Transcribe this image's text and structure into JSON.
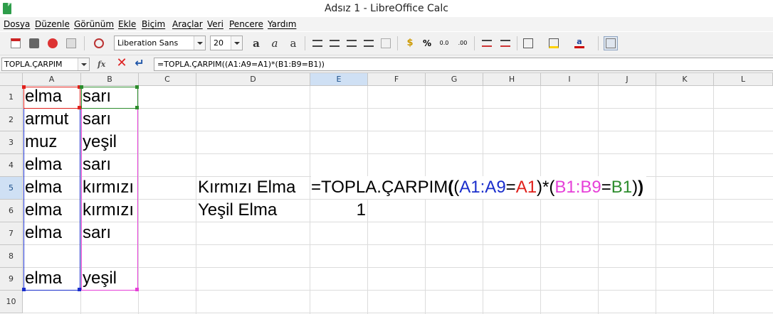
{
  "window": {
    "title": "Adsız 1 - LibreOffice Calc"
  },
  "menu": [
    "Dosya",
    "Düzenle",
    "Görünüm",
    "Ekle",
    "Biçim",
    "Araçlar",
    "Veri",
    "Pencere",
    "Yardım"
  ],
  "toolbar": {
    "font_name": "Liberation Sans",
    "font_size": "20"
  },
  "formula_bar": {
    "name_box": "TOPLA.ÇARPIM",
    "formula": "=TOPLA.ÇARPIM((A1:A9=A1)*(B1:B9=B1))"
  },
  "columns": [
    "A",
    "B",
    "C",
    "D",
    "E",
    "F",
    "G",
    "H",
    "I",
    "J",
    "K",
    "L"
  ],
  "rows": [
    "1",
    "2",
    "3",
    "4",
    "5",
    "6",
    "7",
    "8",
    "9",
    "10"
  ],
  "active_cell": "E5",
  "cells": {
    "A1": "elma",
    "B1": "sarı",
    "A2": "armut",
    "B2": "sarı",
    "A3": "muz",
    "B3": "yeşil",
    "A4": "elma",
    "B4": "sarı",
    "A5": "elma",
    "B5": "kırmızı",
    "D5": "Kırmızı Elma",
    "A6": "elma",
    "B6": "kırmızı",
    "D6": "Yeşil Elma",
    "E6": "1",
    "A7": "elma",
    "B7": "sarı",
    "A9": "elma",
    "B9": "yeşil"
  },
  "edit_formula": {
    "p1": "=TOPLA.ÇARPIM",
    "p2": "(",
    "p3": "(",
    "p4": "A1:A9",
    "p5": "=",
    "p6": "A1",
    "p7": ")*(",
    "p8": "B1:B9",
    "p9": "=",
    "p10": "B1",
    "p11": ")",
    "p12": ")"
  },
  "colors": {
    "ref_red": "#e0201b",
    "ref_blue": "#1a2ecc",
    "ref_magenta": "#e63fd8",
    "ref_green": "#2d8c2d",
    "active_header": "#cfe0f4"
  }
}
